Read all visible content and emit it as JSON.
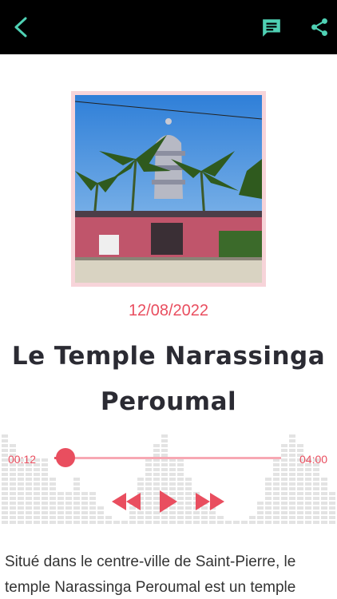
{
  "colors": {
    "accent": "#e94e5f",
    "icon_teal": "#4fd1b4",
    "app_bar": "#000000",
    "title_text": "#2b2b33"
  },
  "app_bar": {
    "back_icon": "chevron-left-icon",
    "comment_icon": "comment-icon",
    "share_icon": "share-icon"
  },
  "article": {
    "date": "12/08/2022",
    "title": "Le Temple Narassinga Peroumal",
    "description": "Situé dans le centre-ville de Saint-Pierre, le temple Narassinga Peroumal est un temple"
  },
  "player": {
    "elapsed": "00:12",
    "total": "04:00",
    "progress": 0.05,
    "rewind_icon": "rewind-icon",
    "play_icon": "play-icon",
    "forward_icon": "fast-forward-icon"
  }
}
